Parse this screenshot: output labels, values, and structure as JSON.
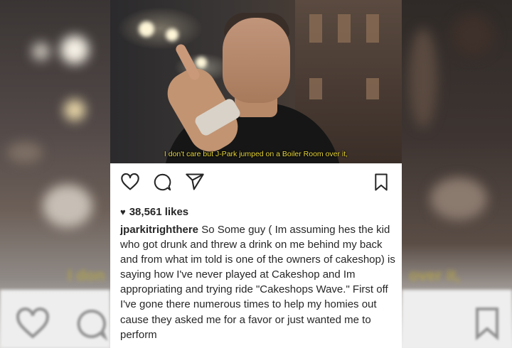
{
  "video": {
    "subtitle": "I don't care but J-Park jumped on a Boiler Room over it,"
  },
  "background": {
    "left_subtitle_fragment": "I don",
    "right_subtitle_fragment": "over it,"
  },
  "post": {
    "likes_icon": "heart-filled-icon",
    "likes": "38,561 likes",
    "username": "jparkitrighthere",
    "caption": "So Some guy ( Im assuming hes the kid who got drunk and threw a drink on me behind my back and from what im told is one of the owners of cakeshop) is saying how I've never played at Cakeshop and Im appropriating and trying ride \"Cakeshops Wave.\" First off I've gone there numerous times to help my homies out cause they asked me for a favor or just wanted me to perform"
  },
  "actions": {
    "like": "heart-outline-icon",
    "comment": "comment-bubble-icon",
    "share": "paper-plane-icon",
    "save": "bookmark-icon"
  },
  "colors": {
    "text": "#262626",
    "subtitle": "#e8d73a",
    "background": "#ffffff"
  }
}
